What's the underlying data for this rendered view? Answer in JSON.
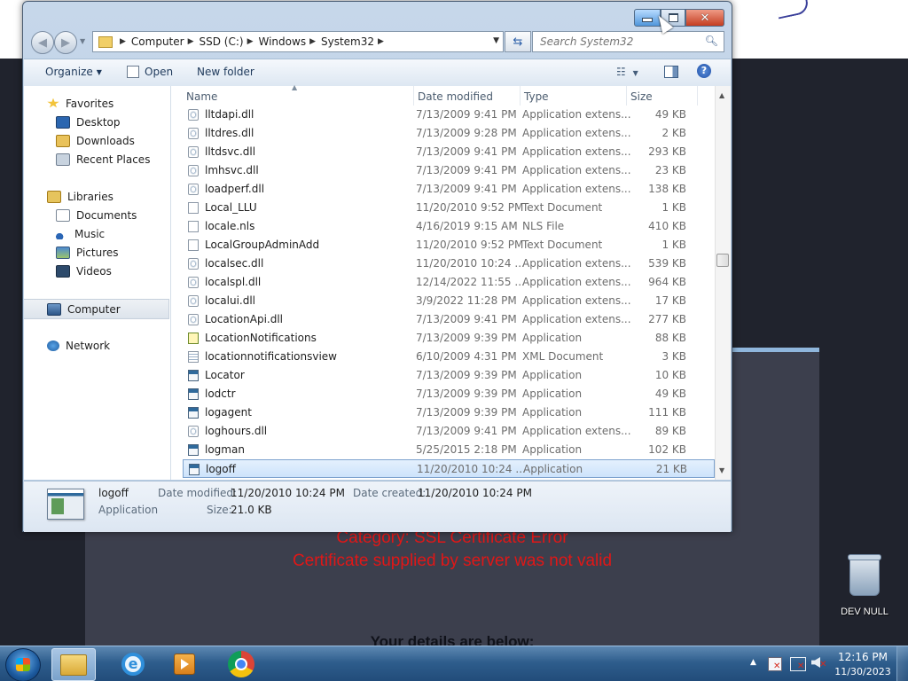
{
  "window": {
    "caption_buttons": {
      "minimize_icon": "minimize-icon",
      "maximize_icon": "maximize-icon",
      "close_glyph": "✕"
    }
  },
  "address": {
    "crumbs": [
      "Computer",
      "SSD (C:)",
      "Windows",
      "System32"
    ],
    "search_placeholder": "Search System32"
  },
  "toolbar": {
    "organize_label": "Organize",
    "open_label": "Open",
    "new_folder_label": "New folder",
    "help_label": "?"
  },
  "navpane": {
    "favorites": {
      "label": "Favorites",
      "items": [
        "Desktop",
        "Downloads",
        "Recent Places"
      ]
    },
    "libraries": {
      "label": "Libraries",
      "items": [
        "Documents",
        "Music",
        "Pictures",
        "Videos"
      ]
    },
    "computer": "Computer",
    "network": "Network"
  },
  "columns": {
    "name": "Name",
    "date_modified": "Date modified",
    "type": "Type",
    "size": "Size"
  },
  "files": [
    {
      "name": "lltdapi.dll",
      "date": "7/13/2009 9:41 PM",
      "type": "Application extens...",
      "size": "49 KB",
      "icon": "gear"
    },
    {
      "name": "lltdres.dll",
      "date": "7/13/2009 9:28 PM",
      "type": "Application extens...",
      "size": "2 KB",
      "icon": "gear"
    },
    {
      "name": "lltdsvc.dll",
      "date": "7/13/2009 9:41 PM",
      "type": "Application extens...",
      "size": "293 KB",
      "icon": "gear"
    },
    {
      "name": "lmhsvc.dll",
      "date": "7/13/2009 9:41 PM",
      "type": "Application extens...",
      "size": "23 KB",
      "icon": "gear"
    },
    {
      "name": "loadperf.dll",
      "date": "7/13/2009 9:41 PM",
      "type": "Application extens...",
      "size": "138 KB",
      "icon": "gear"
    },
    {
      "name": "Local_LLU",
      "date": "11/20/2010 9:52 PM",
      "type": "Text Document",
      "size": "1 KB",
      "icon": "doc"
    },
    {
      "name": "locale.nls",
      "date": "4/16/2019 9:15 AM",
      "type": "NLS File",
      "size": "410 KB",
      "icon": "doc"
    },
    {
      "name": "LocalGroupAdminAdd",
      "date": "11/20/2010 9:52 PM",
      "type": "Text Document",
      "size": "1 KB",
      "icon": "doc"
    },
    {
      "name": "localsec.dll",
      "date": "11/20/2010 10:24 ...",
      "type": "Application extens...",
      "size": "539 KB",
      "icon": "gear"
    },
    {
      "name": "localspl.dll",
      "date": "12/14/2022 11:55 ...",
      "type": "Application extens...",
      "size": "964 KB",
      "icon": "gear"
    },
    {
      "name": "localui.dll",
      "date": "3/9/2022 11:28 PM",
      "type": "Application extens...",
      "size": "17 KB",
      "icon": "gear"
    },
    {
      "name": "LocationApi.dll",
      "date": "7/13/2009 9:41 PM",
      "type": "Application extens...",
      "size": "277 KB",
      "icon": "gear"
    },
    {
      "name": "LocationNotifications",
      "date": "7/13/2009 9:39 PM",
      "type": "Application",
      "size": "88 KB",
      "icon": "check"
    },
    {
      "name": "locationnotificationsview",
      "date": "6/10/2009 4:31 PM",
      "type": "XML Document",
      "size": "3 KB",
      "icon": "xml"
    },
    {
      "name": "Locator",
      "date": "7/13/2009 9:39 PM",
      "type": "Application",
      "size": "10 KB",
      "icon": "app"
    },
    {
      "name": "lodctr",
      "date": "7/13/2009 9:39 PM",
      "type": "Application",
      "size": "49 KB",
      "icon": "app"
    },
    {
      "name": "logagent",
      "date": "7/13/2009 9:39 PM",
      "type": "Application",
      "size": "111 KB",
      "icon": "app"
    },
    {
      "name": "loghours.dll",
      "date": "7/13/2009 9:41 PM",
      "type": "Application extens...",
      "size": "89 KB",
      "icon": "gear"
    },
    {
      "name": "logman",
      "date": "5/25/2015 2:18 PM",
      "type": "Application",
      "size": "102 KB",
      "icon": "app"
    },
    {
      "name": "logoff",
      "date": "11/20/2010 10:24 ...",
      "type": "Application",
      "size": "21 KB",
      "icon": "app",
      "selected": true
    }
  ],
  "details": {
    "name": "logoff",
    "kind": "Application",
    "modified_label": "Date modified:",
    "modified_value": "11/20/2010 10:24 PM",
    "created_label": "Date created:",
    "created_value": "11/20/2010 10:24 PM",
    "size_label": "Size:",
    "size_value": "21.0 KB"
  },
  "background_page": {
    "category": "Category: SSL Certificate Error",
    "message": "Certificate supplied by server was not valid",
    "details_heading": "Your details are below:"
  },
  "desktop": {
    "recycle_label": "DEV NULL"
  },
  "taskbar": {
    "time": "12:16 PM",
    "date": "11/30/2023",
    "apps": [
      "windows-explorer",
      "internet-explorer",
      "media-player",
      "chrome"
    ]
  },
  "colors": {
    "error_text": "#e01717",
    "selection": "#cde3fb",
    "taskbar": "#2e5d8c"
  }
}
